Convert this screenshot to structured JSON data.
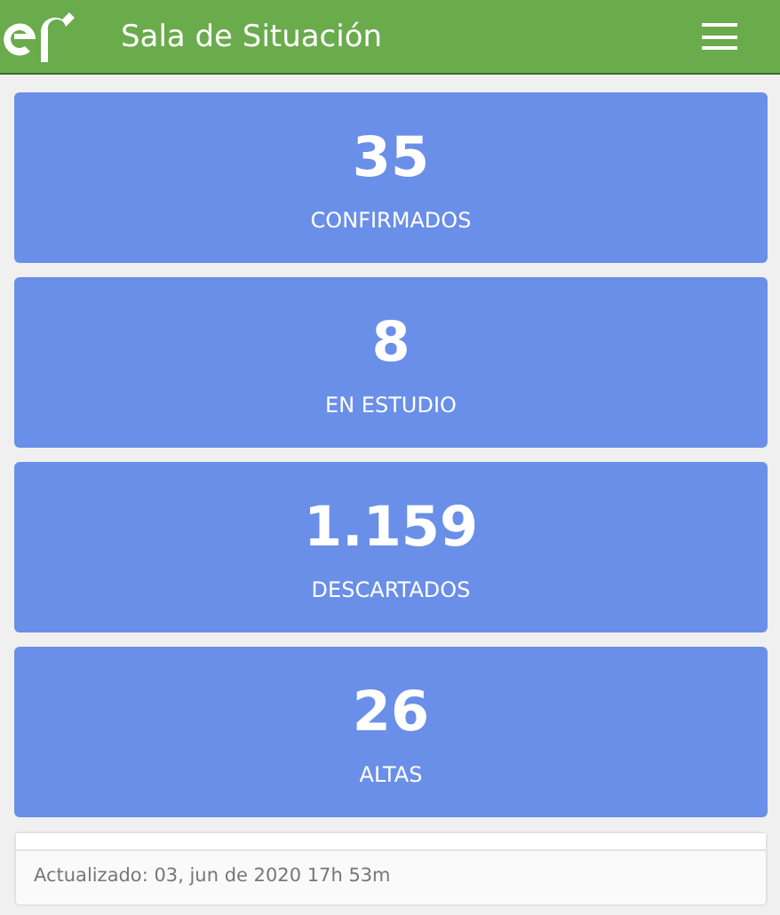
{
  "header": {
    "title": "Sala de Situación"
  },
  "stats": [
    {
      "value": "35",
      "label": "CONFIRMADOS"
    },
    {
      "value": "8",
      "label": "EN ESTUDIO"
    },
    {
      "value": "1.159",
      "label": "DESCARTADOS"
    },
    {
      "value": "26",
      "label": "ALTAS"
    }
  ],
  "footer": {
    "updated": "Actualizado: 03, jun de 2020 17h 53m"
  }
}
